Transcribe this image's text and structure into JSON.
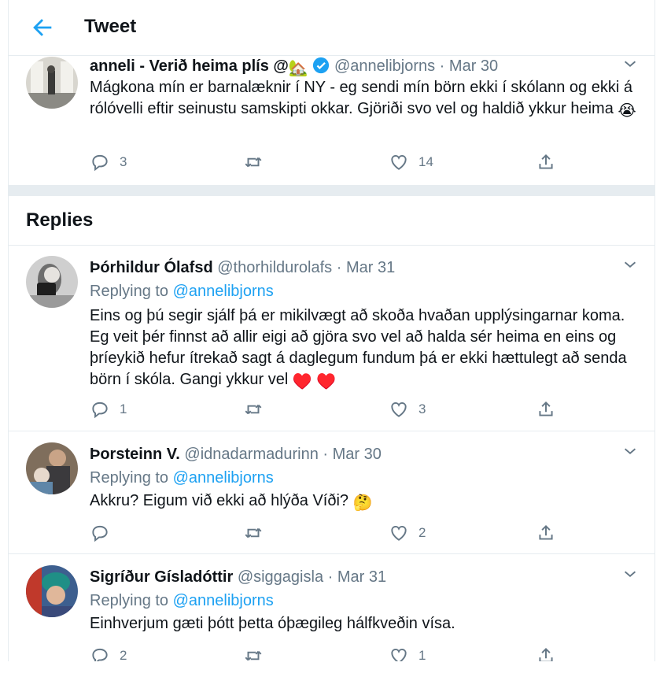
{
  "header": {
    "title": "Tweet"
  },
  "main_tweet": {
    "name": "anneli - Verið heima plís @",
    "name_emoji": "🏡",
    "handle": "@annelibjorns",
    "separator": "·",
    "date": "Mar 30",
    "text": "Mágkona mín er barnalæknir í NY - eg sendi mín börn ekki í skólann og ekki á rólóvelli eftir seinustu samskipti okkar. Gjöriði svo vel og haldið ykkur heima",
    "text_emoji": "😭",
    "reply_count": "3",
    "like_count": "14"
  },
  "replies_title": "Replies",
  "replying_prefix": "Replying to",
  "replies": [
    {
      "name": "Þórhildur Ólafsd",
      "handle": "@thorhildurolafs",
      "date": "Mar 31",
      "reply_to": "@annelibjorns",
      "text": "Eins og þú segir sjálf þá er mikilvægt að skoða hvaðan upplýsingarnar koma. Eg veit þér finnst að allir eigi að gjöra svo vel að halda sér heima en eins og þríeykið hefur ítrekað sagt á daglegum fundum þá er ekki hættulegt að senda börn í skóla. Gangi ykkur vel",
      "text_emoji": "♥️ ♥️",
      "reply_count": "1",
      "like_count": "3"
    },
    {
      "name": "Þorsteinn V.",
      "handle": "@idnadarmadurinn",
      "date": "Mar 30",
      "reply_to": "@annelibjorns",
      "text": "Akkru? Eigum við ekki að hlýða Víði?",
      "text_emoji": "🤔",
      "reply_count": "",
      "like_count": "2"
    },
    {
      "name": "Sigríður Gísladóttir",
      "handle": "@siggagisla",
      "date": "Mar 31",
      "reply_to": "@annelibjorns",
      "text": "Einhverjum gæti þótt þetta óþægileg hálfkveðin vísa.",
      "text_emoji": "",
      "reply_count": "2",
      "like_count": "1"
    }
  ],
  "colors": {
    "accent": "#1da1f2",
    "secondary_text": "#657786",
    "border": "#e6ecf0",
    "heart": "#e0245e"
  },
  "icons": [
    "back-arrow-icon",
    "verified-badge-icon",
    "chevron-down-icon",
    "reply-icon",
    "retweet-icon",
    "like-icon",
    "share-icon"
  ]
}
